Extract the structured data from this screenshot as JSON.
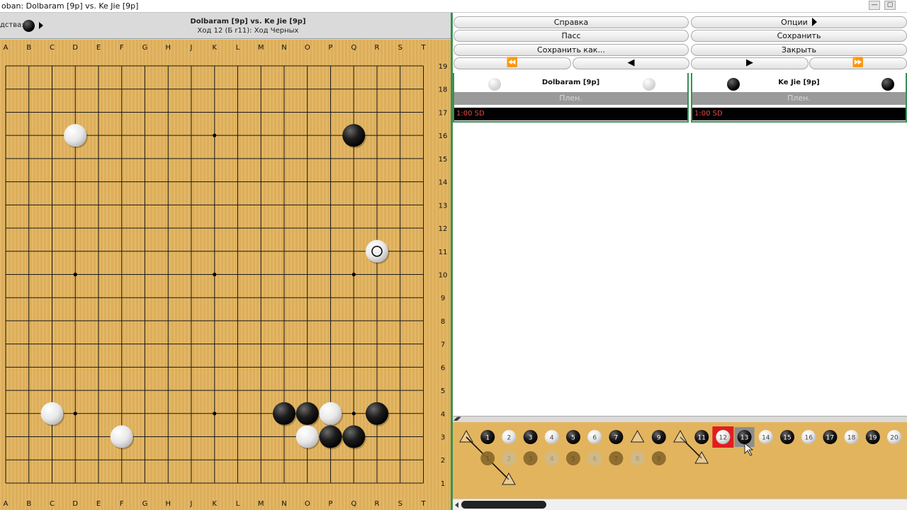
{
  "window": {
    "title": "oban: Dolbaram [9p] vs. Ke Jie [9p]",
    "minimize_glyph": "—",
    "maximize_glyph": "▢"
  },
  "info": {
    "turn_label": "дства:",
    "game_title": "Dolbaram [9p] vs. Ke Jie [9p]",
    "move_status": "Ход 12 (Б r11): Ход Черных"
  },
  "board": {
    "columns": [
      "A",
      "B",
      "C",
      "D",
      "E",
      "F",
      "G",
      "H",
      "J",
      "K",
      "L",
      "M",
      "N",
      "O",
      "P",
      "Q",
      "R",
      "S",
      "T"
    ],
    "rows": [
      "19",
      "18",
      "17",
      "16",
      "15",
      "14",
      "13",
      "12",
      "11",
      "10",
      "9",
      "8",
      "7",
      "6",
      "5",
      "4",
      "3",
      "2",
      "1"
    ],
    "hoshi": [
      "D16",
      "K16",
      "Q16",
      "D10",
      "K10",
      "Q10",
      "D4",
      "K4",
      "Q4"
    ],
    "stones": [
      {
        "color": "white",
        "pos": "D16"
      },
      {
        "color": "black",
        "pos": "Q16"
      },
      {
        "color": "white",
        "pos": "R11",
        "last": true
      },
      {
        "color": "white",
        "pos": "C4"
      },
      {
        "color": "black",
        "pos": "N4"
      },
      {
        "color": "black",
        "pos": "O4"
      },
      {
        "color": "white",
        "pos": "P4"
      },
      {
        "color": "black",
        "pos": "R4"
      },
      {
        "color": "white",
        "pos": "F3"
      },
      {
        "color": "white",
        "pos": "O3"
      },
      {
        "color": "black",
        "pos": "P3"
      },
      {
        "color": "black",
        "pos": "Q3"
      }
    ],
    "colors": {
      "wood": "#e3b45e",
      "line": "#1a1a1a"
    }
  },
  "controls": {
    "help": "Справка",
    "options": "Опции",
    "pass": "Пасс",
    "save": "Сохранить",
    "save_as": "Сохранить как...",
    "close": "Закрыть",
    "nav": [
      "⏪",
      "◀",
      "▶",
      "⏩"
    ]
  },
  "players": [
    {
      "name": "Dolbaram [9p]",
      "color": "white",
      "captures": "Плен.",
      "clock": "1:00 SD"
    },
    {
      "name": "Ke Jie [9p]",
      "color": "black",
      "captures": "Плен.",
      "clock": "1:00 SD"
    }
  ],
  "splitter": {
    "arrows": "◢◤"
  },
  "move_tree": {
    "main_line": [
      {
        "n": "1",
        "color": "black"
      },
      {
        "n": "2",
        "color": "white"
      },
      {
        "n": "3",
        "color": "black"
      },
      {
        "n": "4",
        "color": "white"
      },
      {
        "n": "5",
        "color": "black"
      },
      {
        "n": "6",
        "color": "white"
      },
      {
        "n": "7",
        "color": "black"
      },
      {
        "n": "",
        "color": "tri"
      },
      {
        "n": "9",
        "color": "black"
      },
      {
        "n": "",
        "color": "tri"
      },
      {
        "n": "11",
        "color": "black"
      },
      {
        "n": "12",
        "color": "white",
        "current": true
      },
      {
        "n": "13",
        "color": "black",
        "hover": true
      },
      {
        "n": "14",
        "color": "white"
      },
      {
        "n": "15",
        "color": "black"
      },
      {
        "n": "16",
        "color": "white"
      },
      {
        "n": "17",
        "color": "black"
      },
      {
        "n": "18",
        "color": "white"
      },
      {
        "n": "19",
        "color": "black"
      },
      {
        "n": "20",
        "color": "white"
      }
    ],
    "variation": [
      "1",
      "2",
      "3",
      "4",
      "5",
      "6",
      "7",
      "8",
      "9"
    ],
    "accent": "#e01e1e"
  }
}
